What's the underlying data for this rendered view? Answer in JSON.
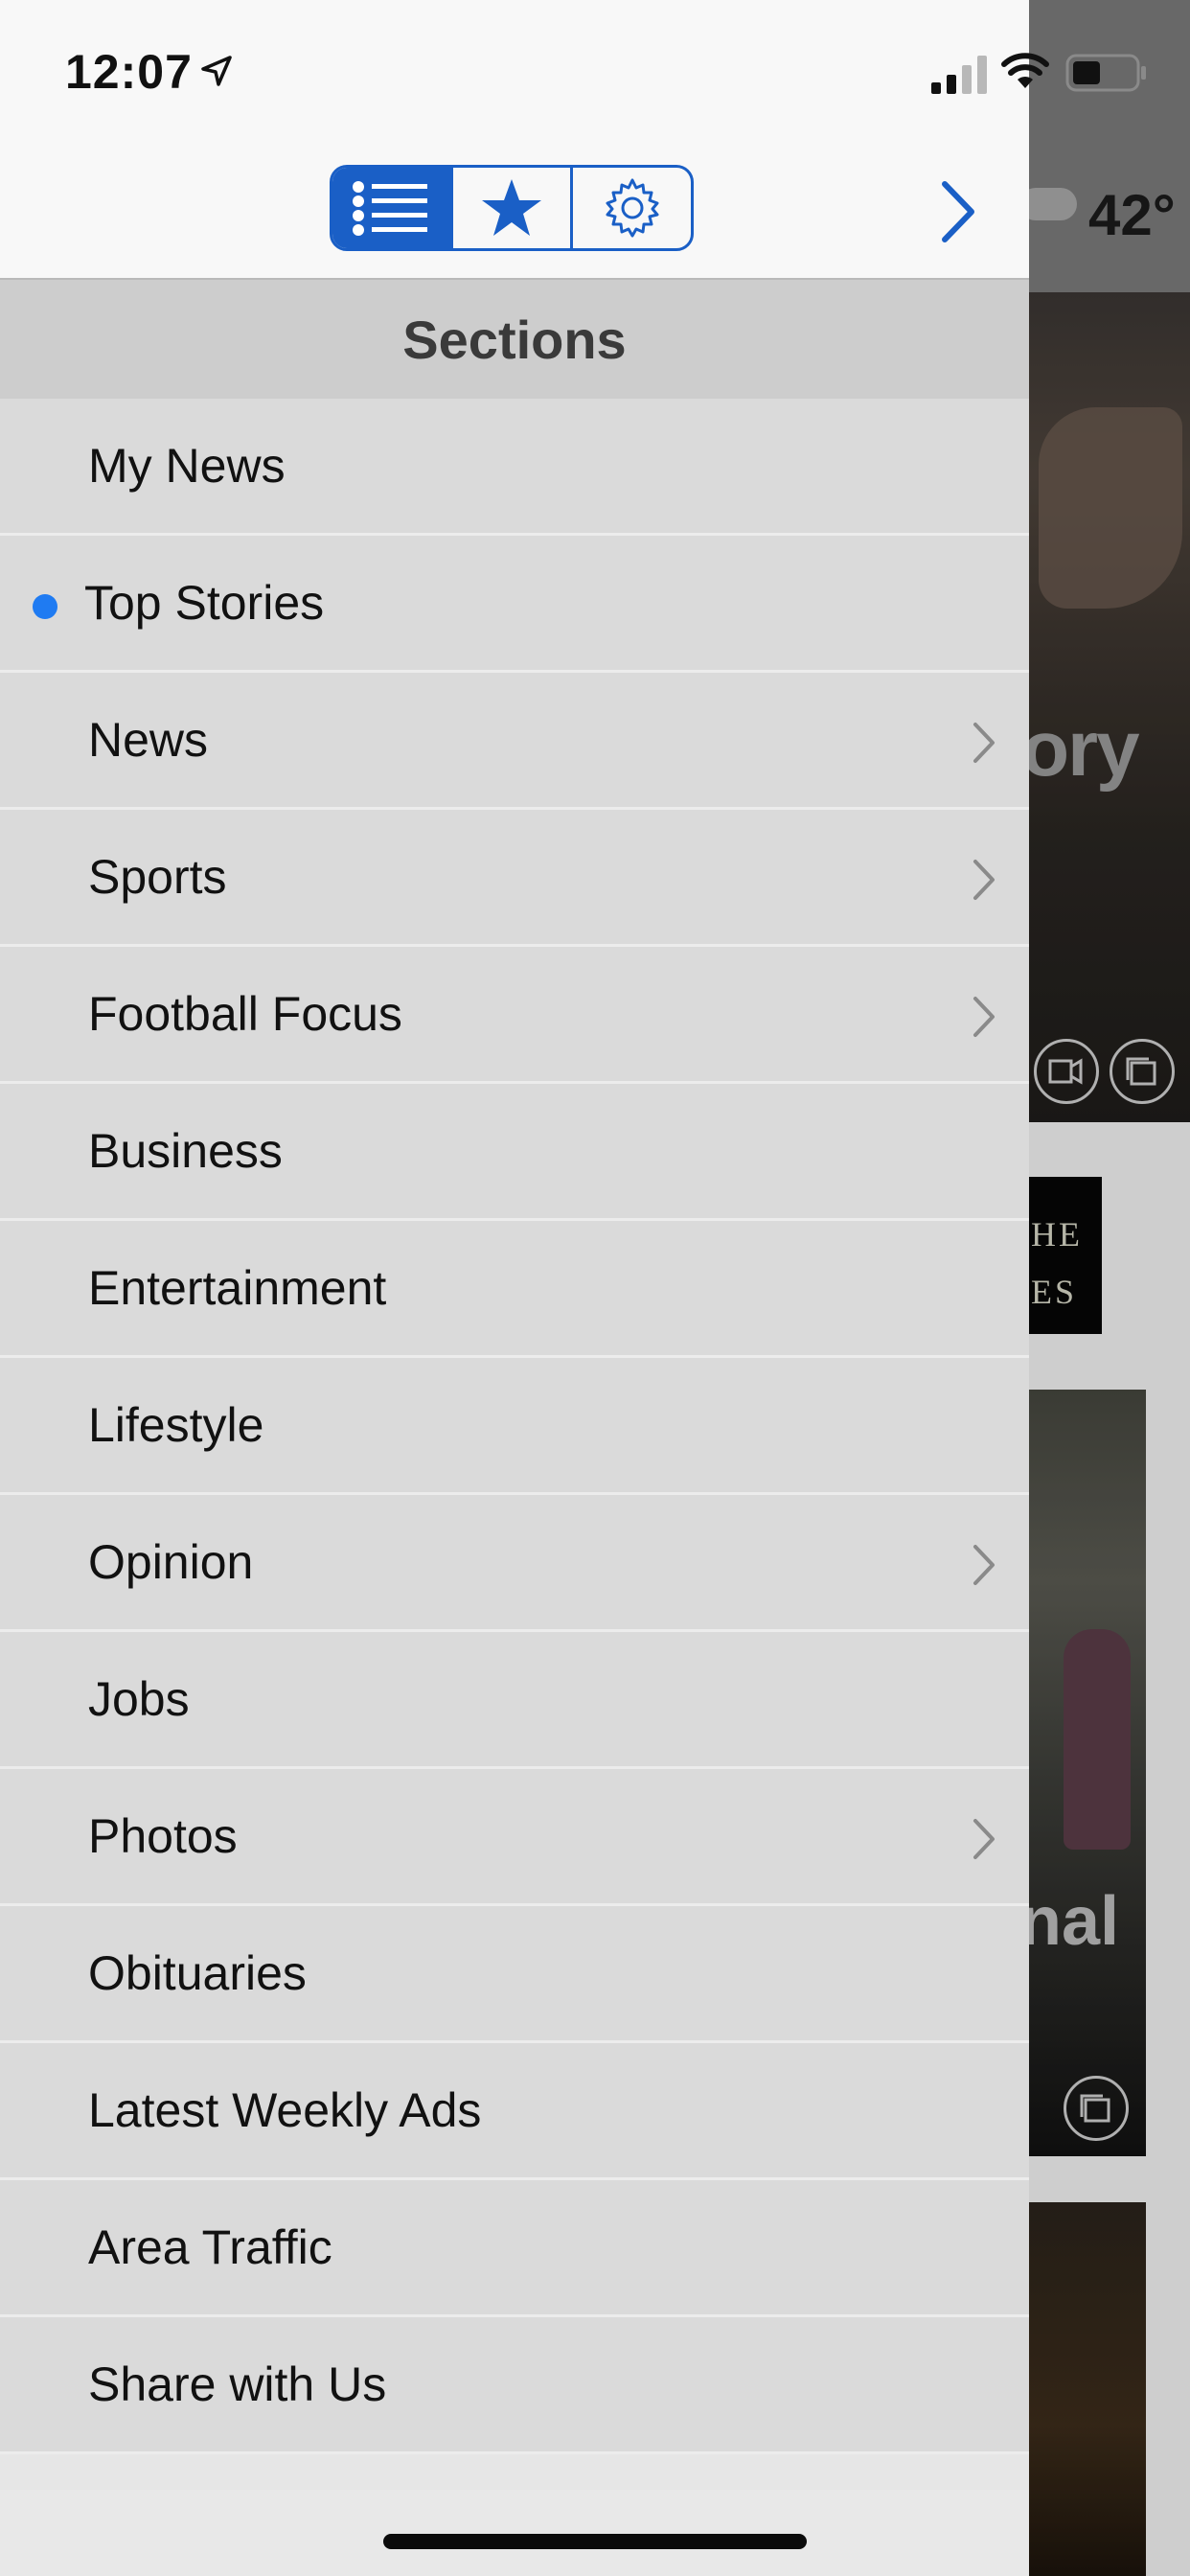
{
  "status_bar": {
    "time": "12:07"
  },
  "toolbar": {
    "segments": [
      {
        "name": "sections-list",
        "active": true
      },
      {
        "name": "favorites-star",
        "active": false
      },
      {
        "name": "settings-gear",
        "active": false
      }
    ],
    "accent_color": "#1a5fc6"
  },
  "background": {
    "temperature": "42°",
    "headline_fragment_1": "ory",
    "ad_fragment_line1": "HE",
    "ad_fragment_line2": "ES",
    "headline_fragment_2": "nal"
  },
  "sections": {
    "title": "Sections",
    "items": [
      {
        "label": "My News",
        "has_submenu": false,
        "selected": false
      },
      {
        "label": "Top Stories",
        "has_submenu": false,
        "selected": true
      },
      {
        "label": "News",
        "has_submenu": true,
        "selected": false
      },
      {
        "label": "Sports",
        "has_submenu": true,
        "selected": false
      },
      {
        "label": "Football Focus",
        "has_submenu": true,
        "selected": false
      },
      {
        "label": "Business",
        "has_submenu": false,
        "selected": false
      },
      {
        "label": "Entertainment",
        "has_submenu": false,
        "selected": false
      },
      {
        "label": "Lifestyle",
        "has_submenu": false,
        "selected": false
      },
      {
        "label": "Opinion",
        "has_submenu": true,
        "selected": false
      },
      {
        "label": "Jobs",
        "has_submenu": false,
        "selected": false
      },
      {
        "label": "Photos",
        "has_submenu": true,
        "selected": false
      },
      {
        "label": "Obituaries",
        "has_submenu": false,
        "selected": false
      },
      {
        "label": "Latest Weekly Ads",
        "has_submenu": false,
        "selected": false
      },
      {
        "label": "Area Traffic",
        "has_submenu": false,
        "selected": false
      },
      {
        "label": "Share with Us",
        "has_submenu": false,
        "selected": false
      }
    ],
    "selected_dot_color": "#1f7bf2"
  }
}
